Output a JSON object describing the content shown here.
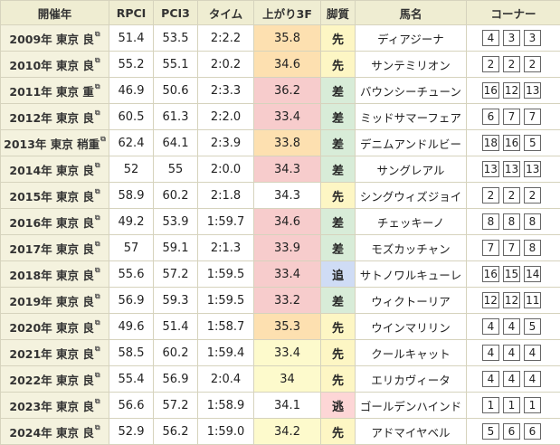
{
  "headers": [
    "開催年",
    "RPCI",
    "PCI3",
    "タイム",
    "上がり3F",
    "脚質",
    "馬名",
    "コーナー"
  ],
  "colors": {
    "header_bg": "#efedd2",
    "year_bg": "#f4f2de",
    "agari_red": "#f7cccc",
    "agari_orange": "#fde0b0",
    "agari_yellow": "#fdfacc",
    "ashi_nige": "#fdd6d6",
    "ashi_senko": "#fdf6c4",
    "ashi_sashi": "#d8ecd8",
    "ashi_oikomi": "#cfdcf5"
  },
  "rows": [
    {
      "year": "2009年 東京 良",
      "rpci": "51.4",
      "pci3": "53.5",
      "time": "2:2.2",
      "agari": "35.8",
      "agari_color": "orange",
      "ashi": "先",
      "ashi_type": "senko",
      "horse": "ディアジーナ",
      "corners": [
        "4",
        "3",
        "3"
      ]
    },
    {
      "year": "2010年 東京 良",
      "rpci": "55.2",
      "pci3": "55.1",
      "time": "2:0.2",
      "agari": "34.6",
      "agari_color": "orange",
      "ashi": "先",
      "ashi_type": "senko",
      "horse": "サンテミリオン",
      "corners": [
        "2",
        "2",
        "2"
      ]
    },
    {
      "year": "2011年 東京 重",
      "rpci": "46.9",
      "pci3": "50.6",
      "time": "2:3.3",
      "agari": "36.2",
      "agari_color": "red",
      "ashi": "差",
      "ashi_type": "sashi",
      "horse": "バウンシーチューン",
      "corners": [
        "16",
        "12",
        "13"
      ]
    },
    {
      "year": "2012年 東京 良",
      "rpci": "60.5",
      "pci3": "61.3",
      "time": "2:2.0",
      "agari": "33.4",
      "agari_color": "red",
      "ashi": "差",
      "ashi_type": "sashi",
      "horse": "ミッドサマーフェア",
      "corners": [
        "6",
        "7",
        "7"
      ]
    },
    {
      "year": "2013年 東京 稍重",
      "rpci": "62.4",
      "pci3": "64.1",
      "time": "2:3.9",
      "agari": "33.8",
      "agari_color": "orange",
      "ashi": "差",
      "ashi_type": "sashi",
      "horse": "デニムアンドルビー",
      "corners": [
        "18",
        "16",
        "5"
      ]
    },
    {
      "year": "2014年 東京 良",
      "rpci": "52",
      "pci3": "55",
      "time": "2:0.0",
      "agari": "34.3",
      "agari_color": "red",
      "ashi": "差",
      "ashi_type": "sashi",
      "horse": "サングレアル",
      "corners": [
        "13",
        "13",
        "13"
      ]
    },
    {
      "year": "2015年 東京 良",
      "rpci": "58.9",
      "pci3": "60.2",
      "time": "2:1.8",
      "agari": "34.3",
      "agari_color": "none",
      "ashi": "先",
      "ashi_type": "senko",
      "horse": "シングウィズジョイ",
      "corners": [
        "2",
        "2",
        "2"
      ]
    },
    {
      "year": "2016年 東京 良",
      "rpci": "49.2",
      "pci3": "53.9",
      "time": "1:59.7",
      "agari": "34.6",
      "agari_color": "red",
      "ashi": "差",
      "ashi_type": "sashi",
      "horse": "チェッキーノ",
      "corners": [
        "8",
        "8",
        "8"
      ]
    },
    {
      "year": "2017年 東京 良",
      "rpci": "57",
      "pci3": "59.1",
      "time": "2:1.3",
      "agari": "33.9",
      "agari_color": "red",
      "ashi": "差",
      "ashi_type": "sashi",
      "horse": "モズカッチャン",
      "corners": [
        "7",
        "7",
        "8"
      ]
    },
    {
      "year": "2018年 東京 良",
      "rpci": "55.6",
      "pci3": "57.2",
      "time": "1:59.5",
      "agari": "33.4",
      "agari_color": "red",
      "ashi": "追",
      "ashi_type": "oikomi",
      "horse": "サトノワルキューレ",
      "corners": [
        "16",
        "15",
        "14"
      ]
    },
    {
      "year": "2019年 東京 良",
      "rpci": "56.9",
      "pci3": "59.3",
      "time": "1:59.5",
      "agari": "33.2",
      "agari_color": "red",
      "ashi": "差",
      "ashi_type": "sashi",
      "horse": "ウィクトーリア",
      "corners": [
        "12",
        "12",
        "11"
      ]
    },
    {
      "year": "2020年 東京 良",
      "rpci": "49.6",
      "pci3": "51.4",
      "time": "1:58.7",
      "agari": "35.3",
      "agari_color": "orange",
      "ashi": "先",
      "ashi_type": "senko",
      "horse": "ウインマリリン",
      "corners": [
        "4",
        "4",
        "5"
      ]
    },
    {
      "year": "2021年 東京 良",
      "rpci": "58.5",
      "pci3": "60.2",
      "time": "1:59.4",
      "agari": "33.4",
      "agari_color": "yellow",
      "ashi": "先",
      "ashi_type": "senko",
      "horse": "クールキャット",
      "corners": [
        "4",
        "4",
        "4"
      ]
    },
    {
      "year": "2022年 東京 良",
      "rpci": "55.4",
      "pci3": "56.9",
      "time": "2:0.4",
      "agari": "34",
      "agari_color": "yellow",
      "ashi": "先",
      "ashi_type": "senko",
      "horse": "エリカヴィータ",
      "corners": [
        "4",
        "4",
        "4"
      ]
    },
    {
      "year": "2023年 東京 良",
      "rpci": "56.6",
      "pci3": "57.2",
      "time": "1:58.9",
      "agari": "34.1",
      "agari_color": "none",
      "ashi": "逃",
      "ashi_type": "nige",
      "horse": "ゴールデンハインド",
      "corners": [
        "1",
        "1",
        "1"
      ]
    },
    {
      "year": "2024年 東京 良",
      "rpci": "52.9",
      "pci3": "56.2",
      "time": "1:59.0",
      "agari": "34.2",
      "agari_color": "yellow",
      "ashi": "先",
      "ashi_type": "senko",
      "horse": "アドマイヤベル",
      "corners": [
        "5",
        "6",
        "6"
      ]
    }
  ]
}
